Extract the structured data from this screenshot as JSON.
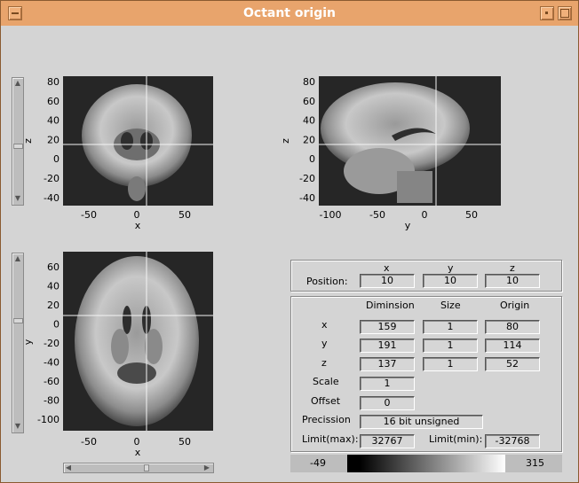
{
  "window": {
    "title": "Octant origin",
    "accent": "#e8a46c",
    "background": "#d4d4d4"
  },
  "views": {
    "coronal": {
      "xlabel": "x",
      "ylabel": "z",
      "xticks": [
        "-50",
        "0",
        "50"
      ],
      "yticks": [
        "80",
        "60",
        "40",
        "20",
        "0",
        "-20",
        "-40"
      ],
      "crosshair": {
        "x": 10,
        "y": 10
      }
    },
    "sagittal": {
      "xlabel": "y",
      "ylabel": "z",
      "xticks": [
        "-100",
        "-50",
        "0",
        "50"
      ],
      "yticks": [
        "80",
        "60",
        "40",
        "20",
        "0",
        "-20",
        "-40"
      ],
      "crosshair": {
        "x": 10,
        "y": 10
      }
    },
    "axial": {
      "xlabel": "x",
      "ylabel": "y",
      "xticks": [
        "-50",
        "0",
        "50"
      ],
      "yticks": [
        "60",
        "40",
        "20",
        "0",
        "-20",
        "-40",
        "-60",
        "-80",
        "-100"
      ],
      "crosshair": {
        "x": 10,
        "y": 10
      }
    }
  },
  "position": {
    "label": "Position:",
    "headers": [
      "x",
      "y",
      "z"
    ],
    "values": [
      "10",
      "10",
      "10"
    ]
  },
  "info": {
    "headers": [
      "Diminsion",
      "Size",
      "Origin"
    ],
    "rows": [
      {
        "label": "x",
        "dimension": "159",
        "size": "1",
        "origin": "80"
      },
      {
        "label": "y",
        "dimension": "191",
        "size": "1",
        "origin": "114"
      },
      {
        "label": "z",
        "dimension": "137",
        "size": "1",
        "origin": "52"
      }
    ],
    "scale_label": "Scale",
    "scale_value": "1",
    "offset_label": "Offset",
    "offset_value": "0",
    "precision_label": "Precission",
    "precision_value": "16 bit unsigned",
    "limit_max_label": "Limit(max):",
    "limit_max_value": "32767",
    "limit_min_label": "Limit(min):",
    "limit_min_value": "-32768"
  },
  "colorbar": {
    "min": "-49",
    "max": "315"
  }
}
